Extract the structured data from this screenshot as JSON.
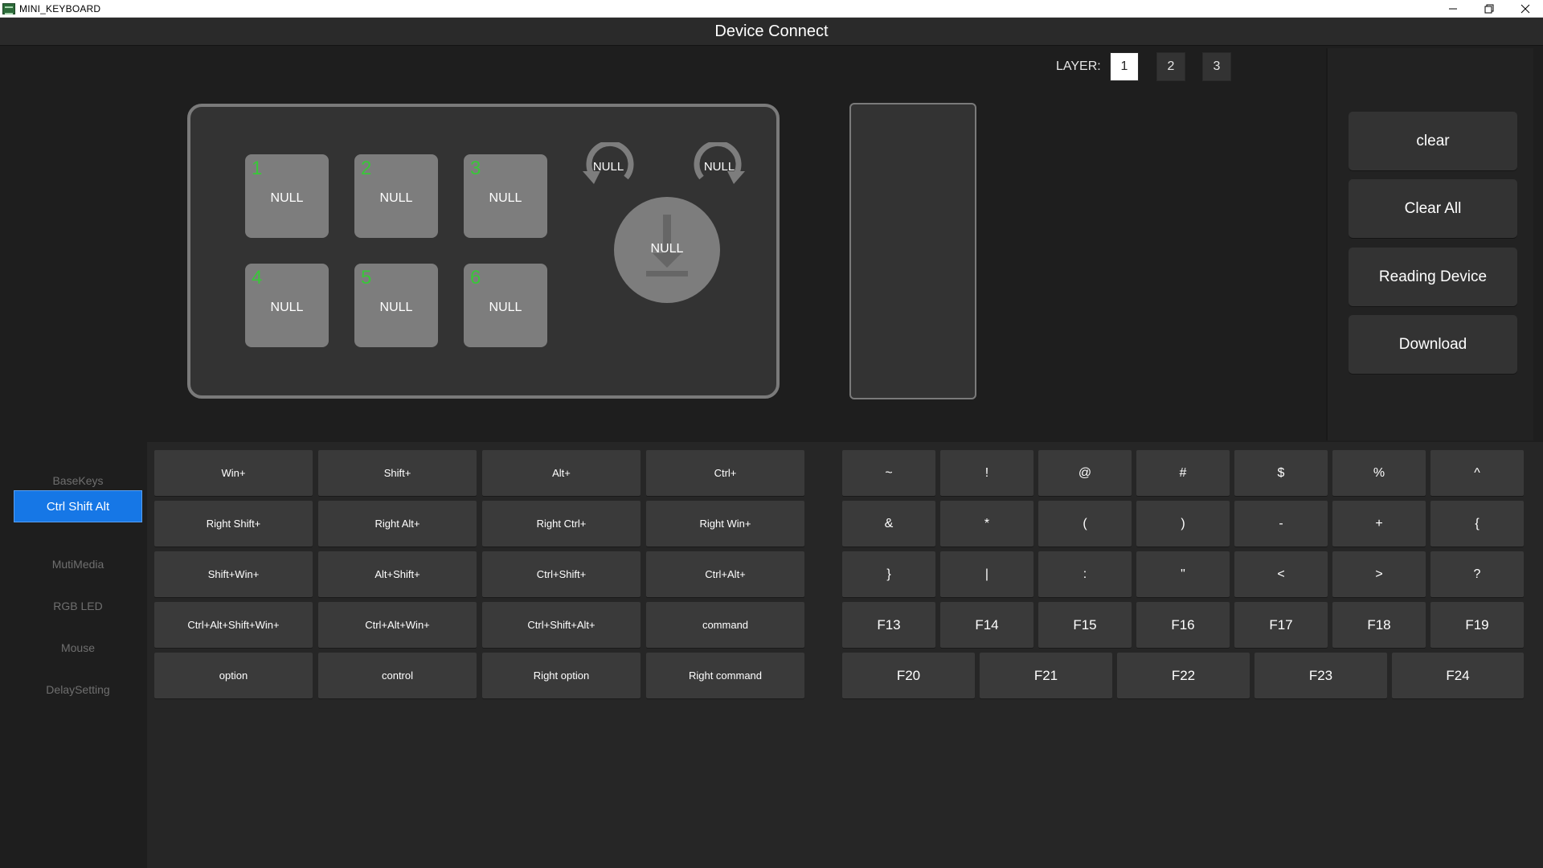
{
  "window": {
    "title": "MINI_KEYBOARD"
  },
  "header": {
    "title": "Device Connect"
  },
  "layer": {
    "label": "LAYER:",
    "options": [
      "1",
      "2",
      "3"
    ],
    "selected": "1"
  },
  "keyboard": {
    "keys": [
      {
        "num": "1",
        "label": "NULL"
      },
      {
        "num": "2",
        "label": "NULL"
      },
      {
        "num": "3",
        "label": "NULL"
      },
      {
        "num": "4",
        "label": "NULL"
      },
      {
        "num": "5",
        "label": "NULL"
      },
      {
        "num": "6",
        "label": "NULL"
      }
    ],
    "knob_ccw_label": "NULL",
    "knob_cw_label": "NULL",
    "knob_press_label": "NULL"
  },
  "actions": {
    "clear": "clear",
    "clear_all": "Clear All",
    "reading_device": "Reading Device",
    "download": "Download"
  },
  "nav": {
    "items": [
      "BaseKeys",
      "Ctrl Shift Alt",
      "MutiMedia",
      "RGB LED",
      "Mouse",
      "DelaySetting"
    ],
    "active": "Ctrl Shift Alt"
  },
  "modifiers": [
    [
      "Win+",
      "Shift+",
      "Alt+",
      "Ctrl+"
    ],
    [
      "Right Shift+",
      "Right Alt+",
      "Right Ctrl+",
      "Right Win+"
    ],
    [
      "Shift+Win+",
      "Alt+Shift+",
      "Ctrl+Shift+",
      "Ctrl+Alt+"
    ],
    [
      "Ctrl+Alt+Shift+Win+",
      "Ctrl+Alt+Win+",
      "Ctrl+Shift+Alt+",
      "command"
    ],
    [
      "option",
      "control",
      "Right option",
      "Right command"
    ]
  ],
  "symbols": [
    [
      "~",
      "!",
      "@",
      "#",
      "$",
      "%",
      "^"
    ],
    [
      "&",
      "*",
      "(",
      ")",
      "-",
      "+",
      "{"
    ],
    [
      "}",
      "|",
      ":",
      "\"",
      "<",
      ">",
      "?"
    ],
    [
      "F13",
      "F14",
      "F15",
      "F16",
      "F17",
      "F18",
      "F19"
    ]
  ],
  "fkeys_last_row": [
    "F20",
    "F21",
    "F22",
    "F23",
    "F24"
  ],
  "colors": {
    "accent": "#1677e6",
    "key_number": "#39c739",
    "background": "#1e1e1e",
    "button": "#3a3a3a"
  }
}
